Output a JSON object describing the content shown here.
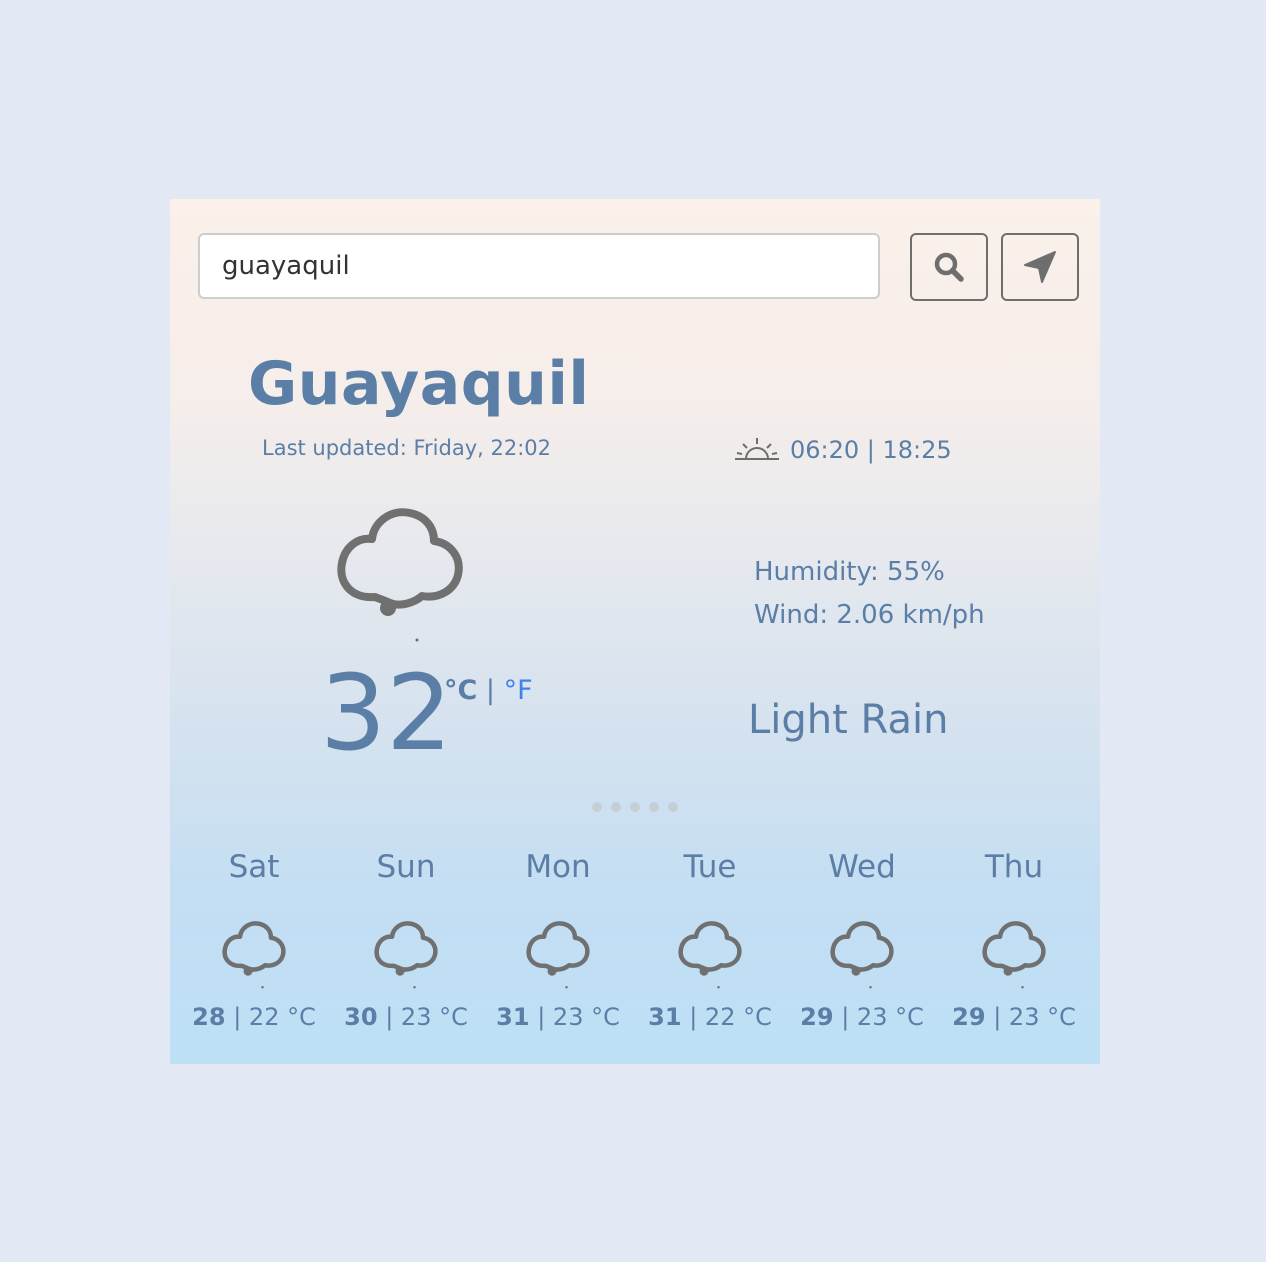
{
  "search": {
    "value": "guayaquil"
  },
  "location": {
    "city": "Guayaquil",
    "last_updated": "Last updated: Friday, 22:02"
  },
  "sun": {
    "times": "06:20 | 18:25",
    "icon": "sunrise-icon"
  },
  "current": {
    "icon": "rain-cloud-icon",
    "temperature": "32",
    "unit_c": "°C",
    "unit_sep": "|",
    "unit_f": "°F",
    "humidity": "Humidity: 55%",
    "wind": "Wind: 2.06 km/ph",
    "description": "Light Rain"
  },
  "forecast": [
    {
      "day": "Sat",
      "high": "28",
      "low": "| 22 °C",
      "icon": "rain-cloud-icon"
    },
    {
      "day": "Sun",
      "high": "30",
      "low": "| 23 °C",
      "icon": "rain-cloud-icon"
    },
    {
      "day": "Mon",
      "high": "31",
      "low": "| 23 °C",
      "icon": "rain-cloud-icon"
    },
    {
      "day": "Tue",
      "high": "31",
      "low": "| 22 °C",
      "icon": "rain-cloud-icon"
    },
    {
      "day": "Wed",
      "high": "29",
      "low": "| 23 °C",
      "icon": "rain-cloud-icon"
    },
    {
      "day": "Thu",
      "high": "29",
      "low": "| 23 °C",
      "icon": "rain-cloud-icon"
    }
  ],
  "colors": {
    "text": "#5b7ea6",
    "link": "#3f82e8",
    "icon": "#6e6e6e",
    "page_background": "#e2e8f4"
  }
}
